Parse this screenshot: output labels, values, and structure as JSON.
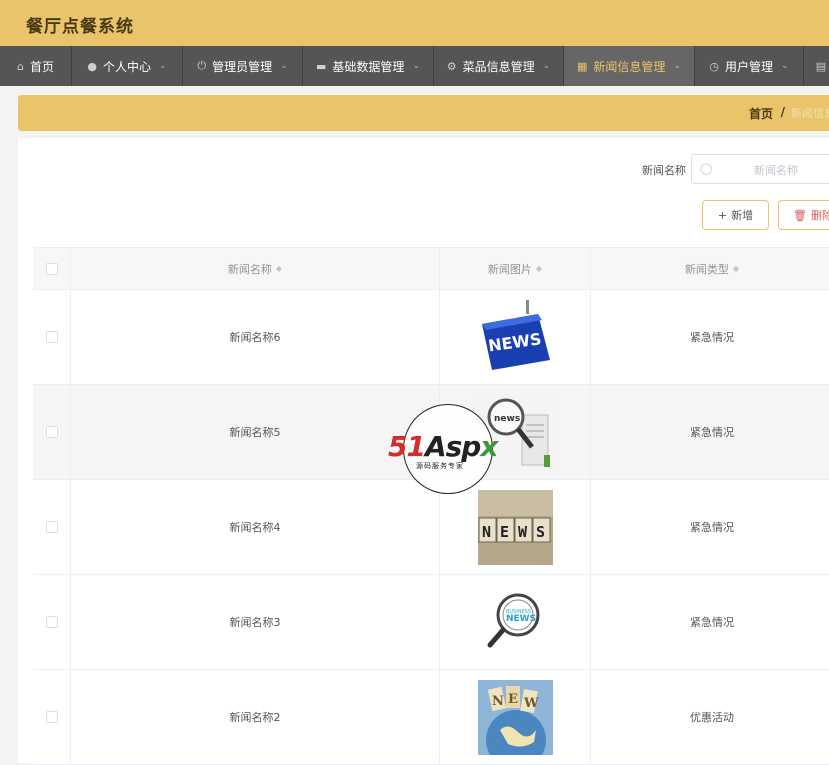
{
  "app": {
    "title": "餐厅点餐系统"
  },
  "nav": [
    {
      "label": "首页",
      "icon": "home-icon",
      "dropdown": false
    },
    {
      "label": "个人中心",
      "icon": "user-icon",
      "dropdown": true
    },
    {
      "label": "管理员管理",
      "icon": "power-icon",
      "dropdown": true
    },
    {
      "label": "基础数据管理",
      "icon": "monitor-icon",
      "dropdown": true
    },
    {
      "label": "菜品信息管理",
      "icon": "gear-icon",
      "dropdown": true
    },
    {
      "label": "新闻信息管理",
      "icon": "grid-icon",
      "dropdown": true,
      "active": true
    },
    {
      "label": "用户管理",
      "icon": "dashboard-icon",
      "dropdown": true
    }
  ],
  "breadcrumb": {
    "home": "首页",
    "separator": "/",
    "current": "新闻信息"
  },
  "search": {
    "label": "新闻名称",
    "placeholder": "新闻名称"
  },
  "actions": {
    "add_label": "新增",
    "delete_label": "删除"
  },
  "table": {
    "columns": [
      "新闻名称",
      "新闻图片",
      "新闻类型"
    ],
    "rows": [
      {
        "name": "新闻名称6",
        "image": "news-keyboard-key",
        "type": "紧急情况"
      },
      {
        "name": "新闻名称5",
        "image": "newspaper-magnifier",
        "type": "紧急情况"
      },
      {
        "name": "新闻名称4",
        "image": "news-letter-blocks",
        "type": "紧急情况"
      },
      {
        "name": "新闻名称3",
        "image": "business-news-magnifier",
        "type": "紧急情况"
      },
      {
        "name": "新闻名称2",
        "image": "news-world-collage",
        "type": "优惠活动"
      }
    ]
  },
  "watermark": {
    "brand": "51Aspx",
    "tagline": "源码服务专家"
  },
  "colors": {
    "accent": "#e9c46a",
    "nav_bg": "#555555",
    "danger": "#e05a5a"
  }
}
